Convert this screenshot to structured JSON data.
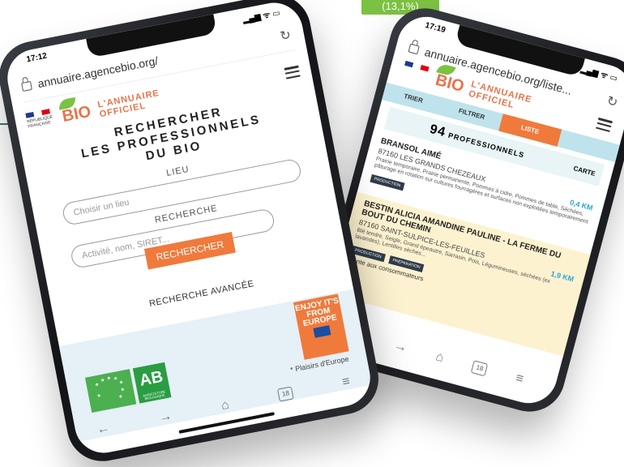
{
  "badge": "(13,1%)",
  "front": {
    "status_time": "17:12",
    "status_icons": "▂▄▆ ᯤ ▭",
    "url": "annuaire.agencebio.org/",
    "refresh_icon": "↻",
    "rf_logo_text": "RÉPUBLIQUE FRANÇAISE",
    "bio_text": "BIO",
    "annuaire_line1": "L'ANNUAIRE",
    "annuaire_line2": "OFFICIEL",
    "title_line1": "RECHERCHER",
    "title_line2": "LES PROFESSIONNELS",
    "title_line3": "DU BIO",
    "lieu_label": "LIEU",
    "lieu_placeholder": "Choisir un lieu",
    "recherche_label": "RECHERCHE",
    "recherche_placeholder": "Activité, nom, SIRET...",
    "search_button": "RECHERCHER",
    "advanced_search": "RECHERCHE AVANCÉE",
    "ab_text": "AB",
    "ab_small": "AGRICULTURE BIOLOGIQUE",
    "enjoy_text": "ENJOY IT'S FROM EUROPE",
    "plaisirs": "* Plaisirs d'Europe",
    "nav": {
      "back": "←",
      "forward": "→",
      "home": "⌂",
      "tabs": "18",
      "menu": "≡"
    }
  },
  "back": {
    "status_time": "17:19",
    "status_icons": "▂▄▆ ᯤ ▭",
    "url": "annuaire.agencebio.org/liste...",
    "refresh_icon": "↻",
    "bio_text": "BIO",
    "annuaire_line1": "L'ANNUAIRE",
    "annuaire_line2": "OFFICIEL",
    "tabs": [
      "TRIER",
      "FILTRER",
      "LISTE",
      "CARTE"
    ],
    "count": "94",
    "count_label": "PROFESSIONNELS",
    "carte": "CARTE",
    "results": [
      {
        "name": "BRANSOL AIMÉ",
        "city": "87160 LES GRANDS CHEZEAUX",
        "distance": "0,4 KM",
        "desc": "Prairie temporaire, Prairie permanente, Pommes à cidre, Pommes de table, Séchées, pâturage en rotation sur cultures fourragères et surfaces non exploitées temporairement",
        "tags": [
          "PRODUCTION"
        ]
      },
      {
        "name": "BESTIN ALICIA AMANDINE PAULINE - LA FERME DU BOUT DU CHEMIN",
        "city": "87160 SAINT-SULPICE-LES-FEUILLES",
        "distance": "1,9 KM",
        "desc": "Blé tendre, Seigle, Grand épeautre, Sarrasin, Pois, Légumineuses, séchées (ex lavandes), Lentilles sèches...",
        "tags": [
          "PRODUCTION",
          "PRÉPARATION"
        ],
        "vente": "Vente aux consommateurs"
      }
    ],
    "nav": {
      "back": "←",
      "forward": "→",
      "home": "⌂",
      "tabs": "18",
      "menu": "≡"
    }
  }
}
